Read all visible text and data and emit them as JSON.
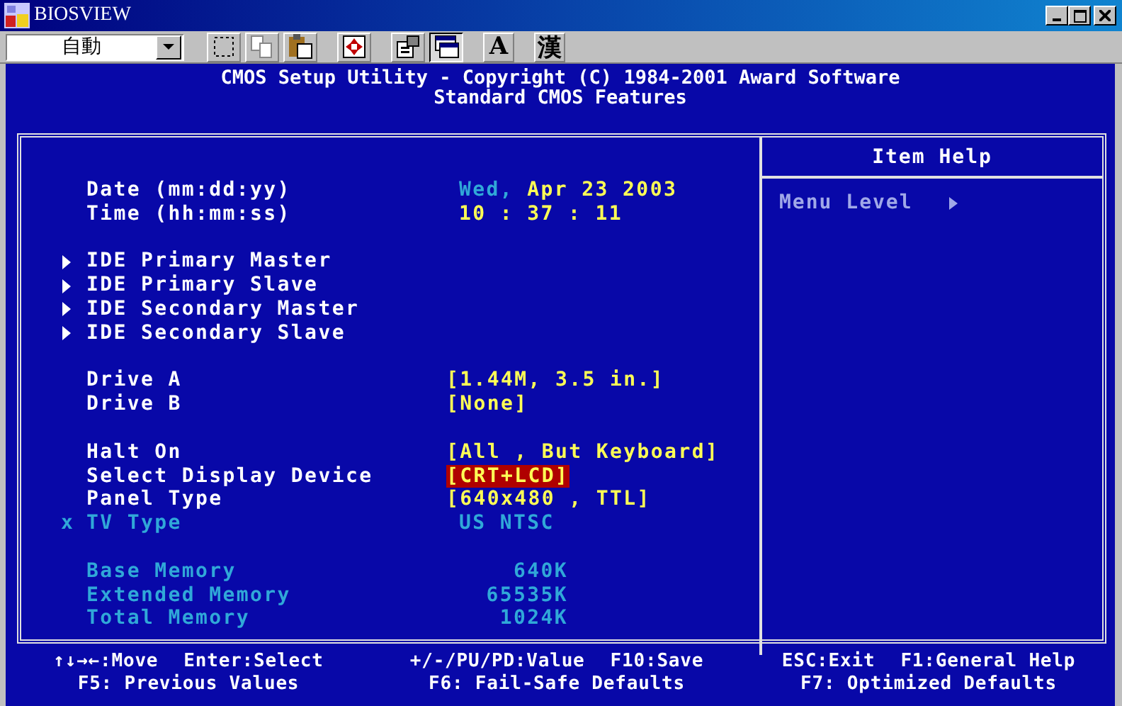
{
  "window": {
    "title": "BIOSVIEW"
  },
  "toolbar": {
    "combo": {
      "value": "自動"
    },
    "buttons": [
      {
        "kind": "select",
        "pressed": false
      },
      {
        "kind": "copy",
        "pressed": false
      },
      {
        "kind": "paste",
        "pressed": false
      },
      {
        "kind": "fit",
        "pressed": false
      },
      {
        "kind": "properties",
        "pressed": false
      },
      {
        "kind": "window",
        "pressed": true
      },
      {
        "kind": "text",
        "label": "A",
        "pressed": false
      },
      {
        "kind": "text",
        "label": "漢",
        "pressed": false
      }
    ]
  },
  "header": [
    "CMOS Setup Utility - Copyright (C) 1984-2001 Award Software",
    "Standard CMOS Features"
  ],
  "settings": [
    {
      "rows": [
        {
          "kind": "date",
          "label": "Date (mm:dd:yy)",
          "day": "Wed,",
          "value": "Apr 23 2003",
          "disabled": false,
          "selected": false
        },
        {
          "kind": "info",
          "label": "Time (hh:mm:ss)",
          "value": "10 : 37 : 11",
          "disabled": false,
          "selected": false
        }
      ]
    },
    {
      "rows": [
        {
          "kind": "submenu",
          "label": "IDE Primary Master",
          "disabled": false,
          "selected": false
        },
        {
          "kind": "submenu",
          "label": "IDE Primary Slave",
          "disabled": false,
          "selected": false
        },
        {
          "kind": "submenu",
          "label": "IDE Secondary Master",
          "disabled": false,
          "selected": false
        },
        {
          "kind": "submenu",
          "label": "IDE Secondary Slave",
          "disabled": false,
          "selected": false
        }
      ]
    },
    {
      "rows": [
        {
          "kind": "option",
          "label": "Drive A",
          "value": "[1.44M, 3.5 in.]",
          "disabled": false,
          "selected": false
        },
        {
          "kind": "option",
          "label": "Drive B",
          "value": "[None]",
          "disabled": false,
          "selected": false
        }
      ]
    },
    {
      "rows": [
        {
          "kind": "option",
          "label": "Halt On",
          "value": "[All , But Keyboard]",
          "disabled": false,
          "selected": false
        },
        {
          "kind": "option",
          "label": "Select Display Device",
          "value": "[CRT+LCD]",
          "disabled": false,
          "selected": true
        },
        {
          "kind": "option",
          "label": "Panel Type",
          "value": "[640x480 , TTL]",
          "disabled": false,
          "selected": false
        },
        {
          "kind": "info",
          "marker": "x",
          "label": "TV Type",
          "value": "US NTSC",
          "disabled": true,
          "selected": false
        }
      ]
    },
    {
      "rows": [
        {
          "kind": "memory",
          "label": "Base Memory",
          "value": "640K",
          "disabled": true,
          "selected": false
        },
        {
          "kind": "memory",
          "label": "Extended Memory",
          "value": "65535K",
          "disabled": true,
          "selected": false
        },
        {
          "kind": "memory",
          "label": "Total Memory",
          "value": "1024K",
          "disabled": true,
          "selected": false
        }
      ]
    }
  ],
  "item_help": {
    "title": "Item Help",
    "menu_level": "Menu Level"
  },
  "footer": [
    {
      "lines": [
        [
          "↑↓→←:Move",
          "Enter:Select"
        ],
        [
          "F5: Previous Values"
        ]
      ]
    },
    {
      "lines": [
        [
          "+/-/PU/PD:Value",
          "F10:Save"
        ],
        [
          "F6: Fail-Safe Defaults"
        ]
      ]
    },
    {
      "lines": [
        [
          "ESC:Exit",
          "F1:General Help"
        ],
        [
          "F7: Optimized Defaults"
        ]
      ]
    }
  ]
}
